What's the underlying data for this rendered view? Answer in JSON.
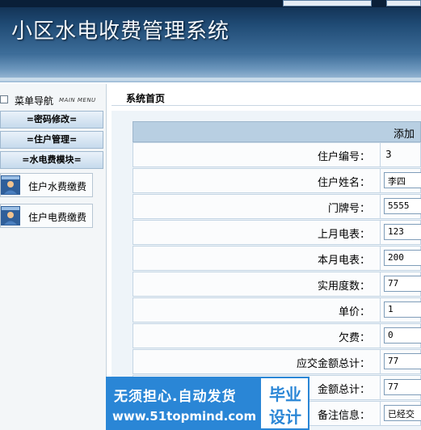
{
  "header": {
    "title": "小区水电收费管理系统"
  },
  "sidebar": {
    "nav_title": "菜单导航",
    "nav_subtitle": "MAIN MENU",
    "menus": [
      "=密码修改=",
      "=住户管理=",
      "=水电费模块="
    ],
    "subitems": [
      "住户水费缴费",
      "住户电费缴费"
    ]
  },
  "breadcrumb": "系统首页",
  "form": {
    "caption": "添加",
    "rows": [
      {
        "label": "住户编号：",
        "value": "3",
        "input": false
      },
      {
        "label": "住户姓名：",
        "value": "李四",
        "input": true
      },
      {
        "label": "门牌号：",
        "value": "5555",
        "input": true
      },
      {
        "label": "上月电表：",
        "value": "123",
        "input": true
      },
      {
        "label": "本月电表：",
        "value": "200",
        "input": true
      },
      {
        "label": "实用度数：",
        "value": "77",
        "input": true
      },
      {
        "label": "单价：",
        "value": "1",
        "input": true
      },
      {
        "label": "欠费：",
        "value": "0",
        "input": true
      },
      {
        "label": "应交金额总计：",
        "value": "77",
        "input": true
      },
      {
        "label": "金额总计：",
        "value": "77",
        "input": true
      },
      {
        "label": "备注信息：",
        "value": "已经交",
        "input": true
      }
    ]
  },
  "watermark": {
    "line1": "无须担心.自动发货",
    "line2": "www.51topmind.com",
    "badge1": "毕业",
    "badge2": "设计"
  }
}
